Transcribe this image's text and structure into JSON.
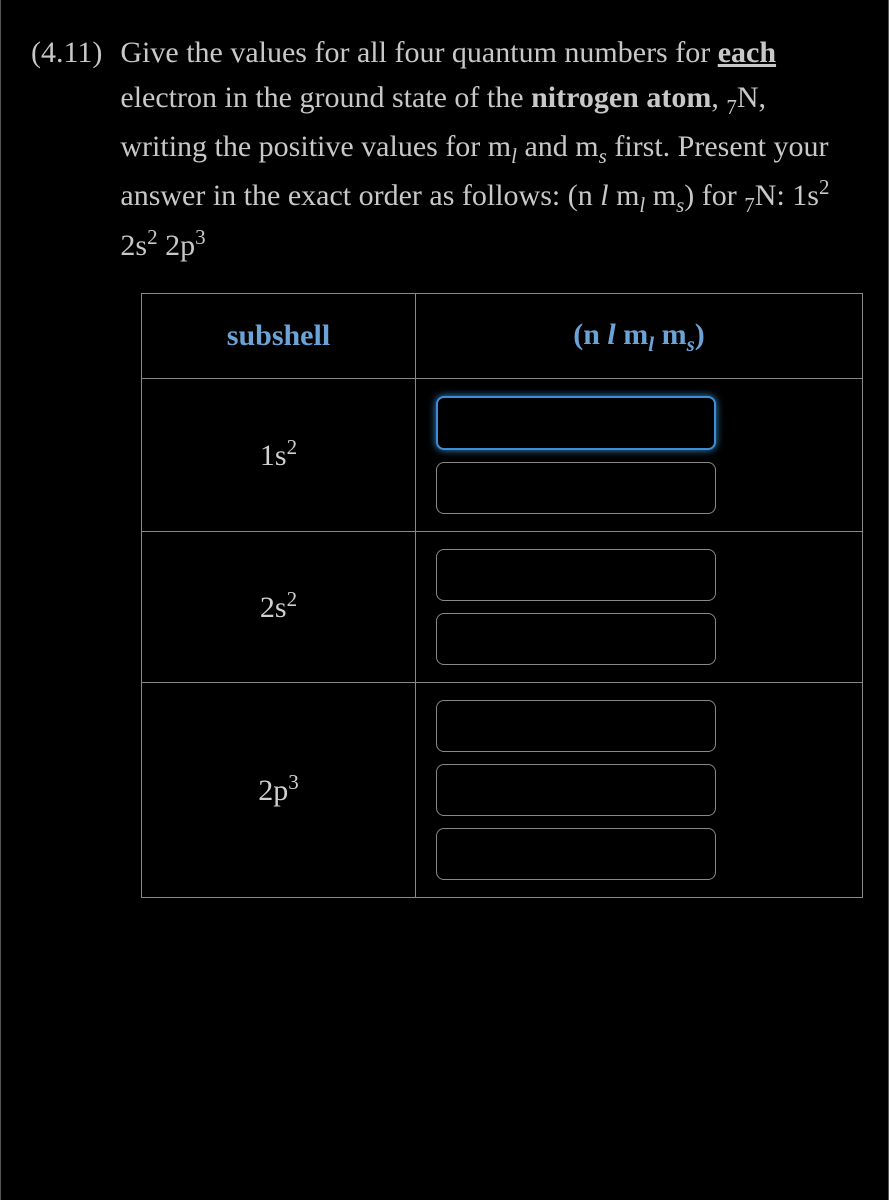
{
  "question": {
    "number": "(4.11)",
    "text_part1": "Give the values for all four quantum numbers for ",
    "each": "each",
    "text_part2": " electron in the ground state of the ",
    "nitrogen": "nitrogen atom",
    "text_part3": ", ",
    "seven": "7",
    "n_symbol": "N",
    "text_part4": ", writing the positive values for m",
    "l_sub": "l",
    "text_part5": " and m",
    "s_sub": "s",
    "text_part6": " first.  Present your answer in the exact order as follows:  (n ",
    "l_italic": "l",
    "text_part7": " m",
    "l_sub2": "l",
    "text_part8": " m",
    "s_sub2": "s",
    "text_part9": ") for  ",
    "seven2": "7",
    "n_symbol2": "N",
    "colon_config": ":  1s",
    "sup2a": "2",
    "space1": " 2s",
    "sup2b": "2",
    "space2": " 2p",
    "sup3": "3"
  },
  "table": {
    "headers": {
      "subshell": "subshell",
      "quantum_pre": "(n ",
      "l_var": "l",
      "quantum_mid1": " m",
      "l_sub": "l",
      "quantum_mid2": " m",
      "s_sub": "s",
      "quantum_post": ")"
    },
    "rows": [
      {
        "subshell_base": "1s",
        "subshell_sup": "2",
        "input_count": 2,
        "values": [
          "",
          ""
        ],
        "focused_index": 0
      },
      {
        "subshell_base": "2s",
        "subshell_sup": "2",
        "input_count": 2,
        "values": [
          "",
          ""
        ],
        "focused_index": -1
      },
      {
        "subshell_base": "2p",
        "subshell_sup": "3",
        "input_count": 3,
        "values": [
          "",
          "",
          ""
        ],
        "focused_index": -1
      }
    ]
  }
}
